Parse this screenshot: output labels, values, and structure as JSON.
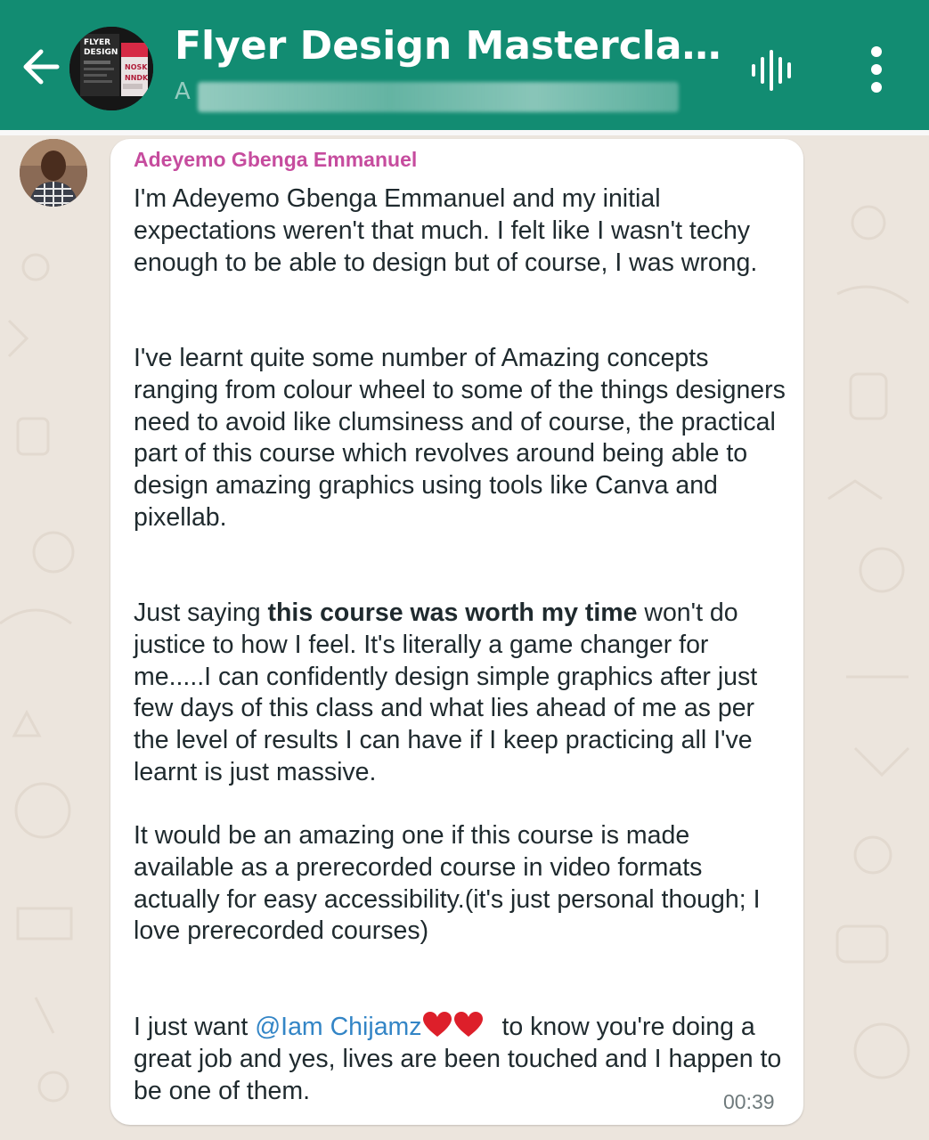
{
  "header": {
    "title": "Flyer Design Masterclass (...",
    "subtitle": "A",
    "avatar_icon": "group-flyer-image",
    "back_icon": "arrow-left-icon",
    "audio_icon": "audio-waveform-icon",
    "menu_icon": "more-vertical-icon",
    "background_color": "#128c72"
  },
  "message": {
    "sender": "Adeyemo Gbenga Emmanuel",
    "sender_color": "#c64c9e",
    "paragraph1": "I'm Adeyemo Gbenga Emmanuel and my initial expectations weren't that much. I felt like I wasn't techy enough to be able to design but of course, I was wrong.",
    "paragraph2": "I've learnt quite some number of Amazing concepts ranging from colour wheel to some of the things designers need to avoid like clumsiness and of course, the practical part of this course which revolves around being able to design amazing graphics using tools like Canva and pixellab.",
    "paragraph3_lead": "Just saying ",
    "paragraph3_bold": "this course was worth my time",
    "paragraph3_rest": " won't do justice to how I feel. It's literally a game changer for me.....I can confidently design simple graphics after just few days of this class and what lies ahead of me as per the level of results I can have if I keep practicing all I've learnt is just massive.",
    "paragraph4": "It would be an amazing one if this course is made available as a prerecorded course in video formats actually for easy accessibility.(it's just personal though; I love prerecorded courses)",
    "paragraph5_lead": "I just want ",
    "mention": "@Iam Chijamz",
    "paragraph5_rest": " to know you're doing a great job and yes, lives are been touched and I happen to be one of them.",
    "hearts_icon": "two-red-hearts-icon",
    "mention_color": "#3385c6",
    "time": "00:39"
  }
}
